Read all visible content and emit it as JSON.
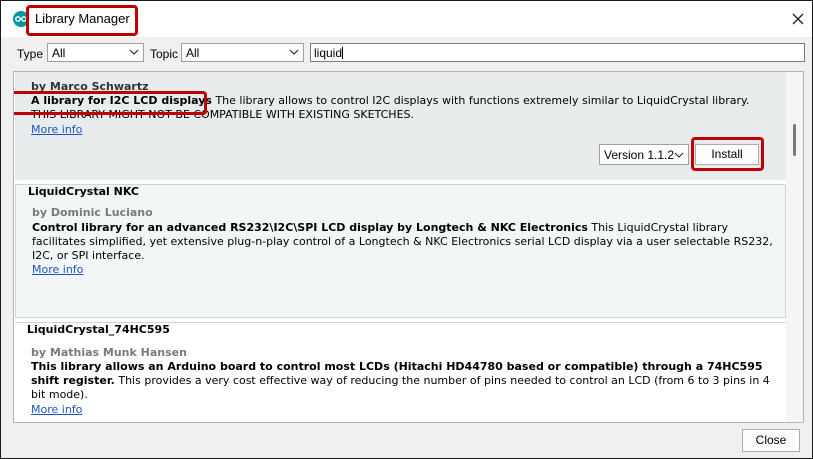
{
  "window": {
    "title": "Library Manager",
    "icon": "arduino-icon"
  },
  "filters": {
    "type_label": "Type",
    "type_value": "All",
    "topic_label": "Topic",
    "topic_value": "All",
    "search_value": "liquid"
  },
  "libraries": [
    {
      "author": "by Marco Schwartz",
      "summary": "A library for I2C LCD displays",
      "description": " The library allows to control I2C displays with functions extremely similar to LiquidCrystal library. THIS LIBRARY MIGHT NOT BE COMPATIBLE WITH EXISTING SKETCHES.",
      "more": "More info",
      "version": "Version 1.1.2",
      "install": "Install"
    },
    {
      "name": "LiquidCrystal NKC",
      "author": "by Dominic Luciano",
      "summary": "Control library for an advanced RS232\\I2C\\SPI LCD display by Longtech & NKC Electronics",
      "description": " This LiquidCrystal library facilitates simplified, yet extensive plug-n-play control of a Longtech & NKC Electronics serial LCD display via a user selectable RS232, I2C, or SPI interface.",
      "more": "More info"
    },
    {
      "name": "LiquidCrystal_74HC595",
      "author": "by Mathias Munk Hansen",
      "summary": "This library allows an Arduino board to control most LCDs (Hitachi HD44780 based or compatible) through a 74HC595 shift register.",
      "description": " This provides a very cost effective way of reducing the number of pins needed to control an LCD (from 6 to 3 pins in 4 bit mode).",
      "more": "More info"
    }
  ],
  "footer": {
    "close": "Close"
  },
  "highlight_color": "#c00000",
  "link_color": "#1a55c8"
}
